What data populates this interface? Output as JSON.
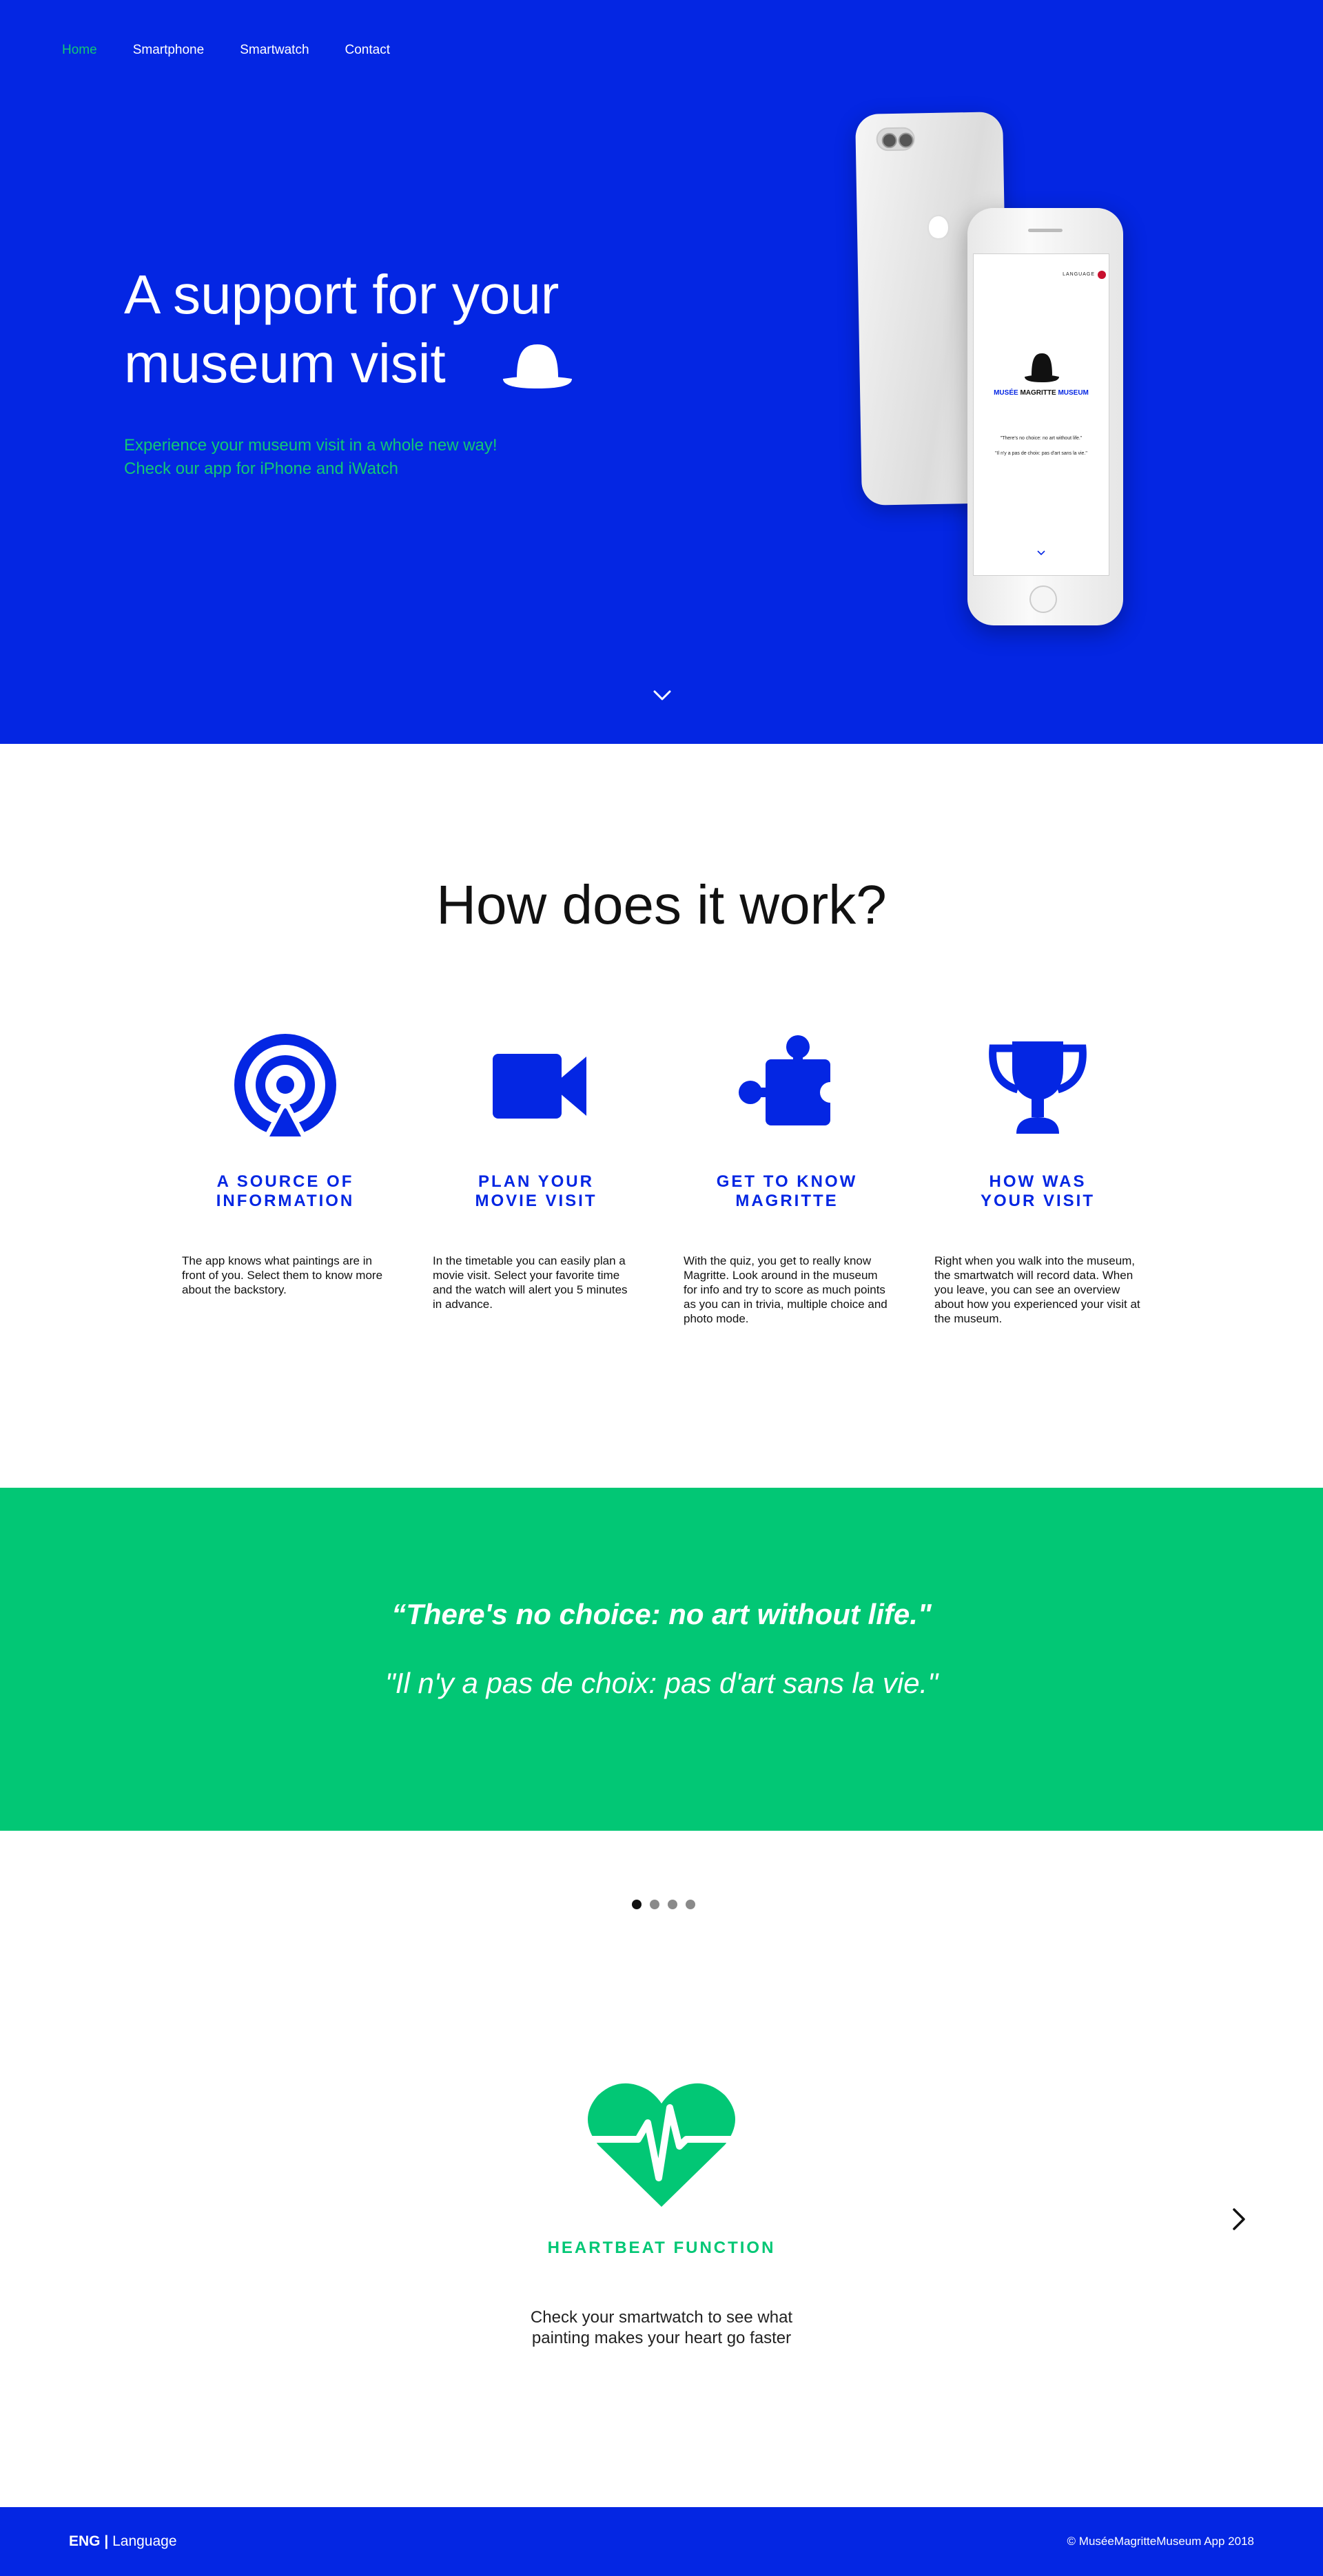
{
  "nav": {
    "items": [
      {
        "label": "Home",
        "active": true
      },
      {
        "label": "Smartphone",
        "active": false
      },
      {
        "label": "Smartwatch",
        "active": false
      },
      {
        "label": "Contact",
        "active": false
      }
    ]
  },
  "hero": {
    "title_line1": "A support for your",
    "title_line2": "museum visit",
    "subtitle_line1": "Experience your museum visit in a whole new way!",
    "subtitle_line2": "Check our app for iPhone and iWatch",
    "hat_icon": "bowler-hat-icon",
    "scroll_icon": "chevron-down-icon"
  },
  "phone_screen": {
    "language": "LANGUAGE",
    "brand_part1": "MUSÉE",
    "brand_part2": "MAGRITTE",
    "brand_part3": "MUSEUM",
    "quote_en": "\"There's no choice: no art without life.\"",
    "quote_fr": "\"Il n'y a pas de choix: pas d'art sans la vie.\""
  },
  "how": {
    "title": "How does it work?",
    "features": [
      {
        "icon": "broadcast-icon",
        "title_line1": "A SOURCE OF",
        "title_line2": "INFORMATION",
        "text": "The app knows what paintings are in front of you. Select them to know more about the backstory."
      },
      {
        "icon": "video-camera-icon",
        "title_line1": "PLAN YOUR",
        "title_line2": "MOVIE VISIT",
        "text": "In the timetable you can easily plan a movie visit. Select your favorite time and the watch will alert you 5 minutes in advance."
      },
      {
        "icon": "puzzle-icon",
        "title_line1": "GET TO KNOW",
        "title_line2": "MAGRITTE",
        "text": "With the quiz, you get to really know Magritte. Look around in the museum for info and try to score as much points as you can in trivia, multiple choice and photo mode."
      },
      {
        "icon": "trophy-icon",
        "title_line1": "HOW WAS",
        "title_line2": "YOUR VISIT",
        "text": "Right when you walk into the museum, the smartwatch will record data. When you leave, you can see an overview about how you experienced your visit at the museum."
      }
    ]
  },
  "quote": {
    "english": "“There's no choice: no art without life.\"",
    "french": "\"Il n'y a pas de choix: pas d'art sans la vie.\""
  },
  "carousel": {
    "dots": 4,
    "active_index": 0,
    "slide": {
      "icon": "heart-pulse-icon",
      "title": "HEARTBEAT FUNCTION",
      "desc_line1": "Check your smartwatch to see what",
      "desc_line2": "painting makes your heart go faster"
    },
    "next_icon": "chevron-right-icon"
  },
  "footer": {
    "lang_code": "ENG",
    "separator": "|",
    "lang_label": "Language",
    "copyright": "© MuséeMagritteMuseum App 2018"
  },
  "colors": {
    "primary_blue": "#0426e3",
    "accent_green": "#02c775",
    "text_dark": "#111111"
  }
}
